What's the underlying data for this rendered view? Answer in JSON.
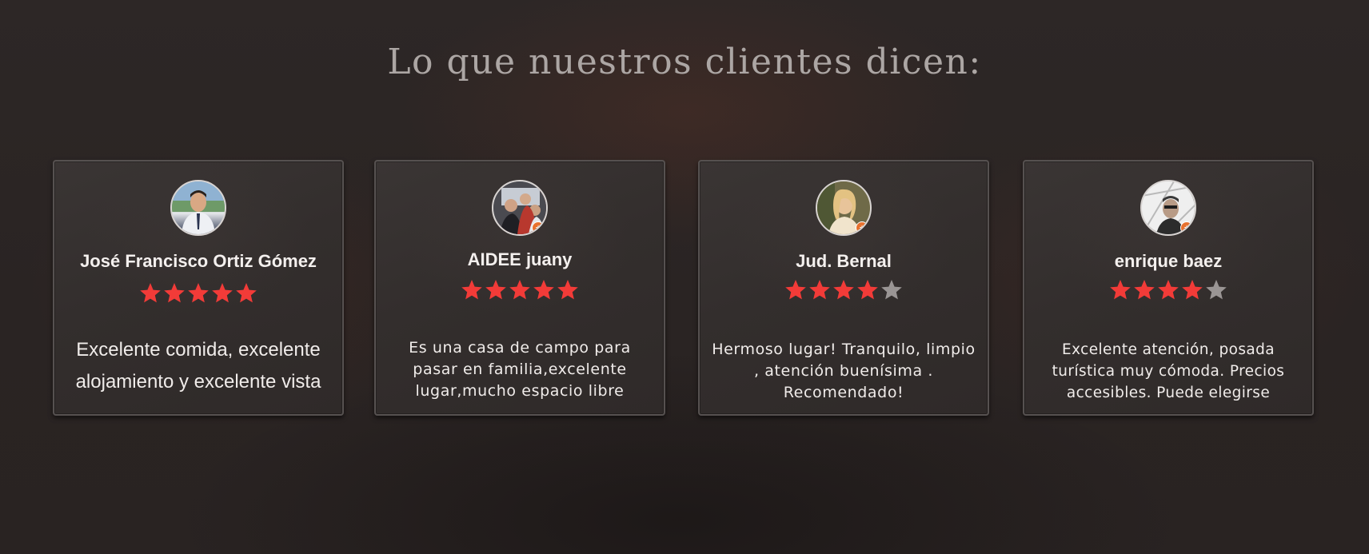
{
  "section_title": "Lo que nuestros clientes dicen:",
  "colors": {
    "star_filled": "#f23b38",
    "star_empty": "#9a9594",
    "background": "#2b2524",
    "card_border": "#565150"
  },
  "reviews": [
    {
      "name": "José Francisco Ortiz Gómez",
      "rating": 5,
      "text": "Excelente comida, excelente alojamiento y excelente vista",
      "avatar_icon": "avatar-photo"
    },
    {
      "name": "AIDEE juany",
      "rating": 5,
      "text": "Es una casa de campo para pasar en familia,excelente lugar,mucho espacio libre",
      "avatar_icon": "avatar-photo"
    },
    {
      "name": "Jud. Bernal",
      "rating": 4,
      "text": "Hermoso lugar! Tranquilo, limpio , atención buenísima . Recomendado!",
      "avatar_icon": "avatar-photo"
    },
    {
      "name": "enrique baez",
      "rating": 4,
      "text": "Excelente atención, posada turística muy cómoda. Precios accesibles. Puede elegirse",
      "avatar_icon": "avatar-photo"
    }
  ]
}
